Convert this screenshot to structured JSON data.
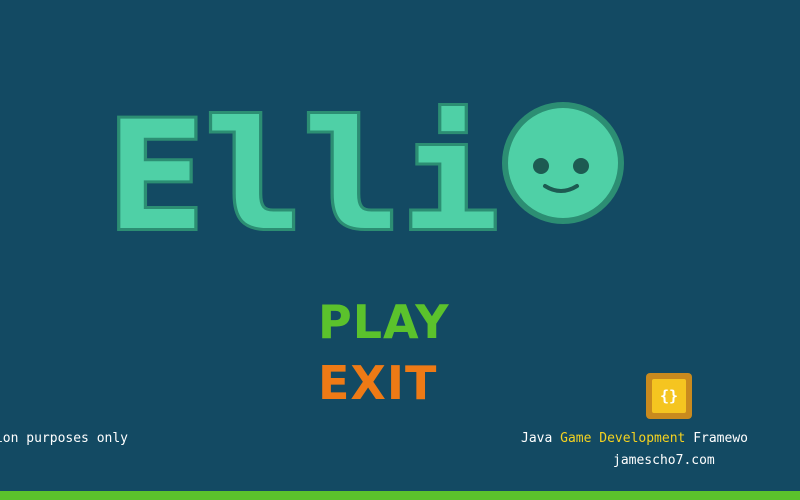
{
  "game": {
    "title": "Elli",
    "menu": {
      "play_label": "PLAY",
      "exit_label": "EXIT"
    }
  },
  "footer": {
    "disclaimer": "nstration purposes only",
    "framework_part1": "Java ",
    "framework_highlight": "Game Development",
    "framework_part2": " Framewo",
    "url": "jamescho7.com",
    "icon_glyph": "{}"
  },
  "colors": {
    "background": "#134a63",
    "logo_fill": "#4fd0a6",
    "logo_outline": "#2c8e73",
    "play": "#5bc22c",
    "exit": "#ee7a15",
    "highlight": "#f5d21f",
    "bottom_bar": "#5bc22c",
    "icon_outer": "#c98a1e",
    "icon_inner": "#f5c520"
  },
  "icons": {
    "logo_face": "smiley-face-icon",
    "framework": "curly-braces-icon"
  }
}
